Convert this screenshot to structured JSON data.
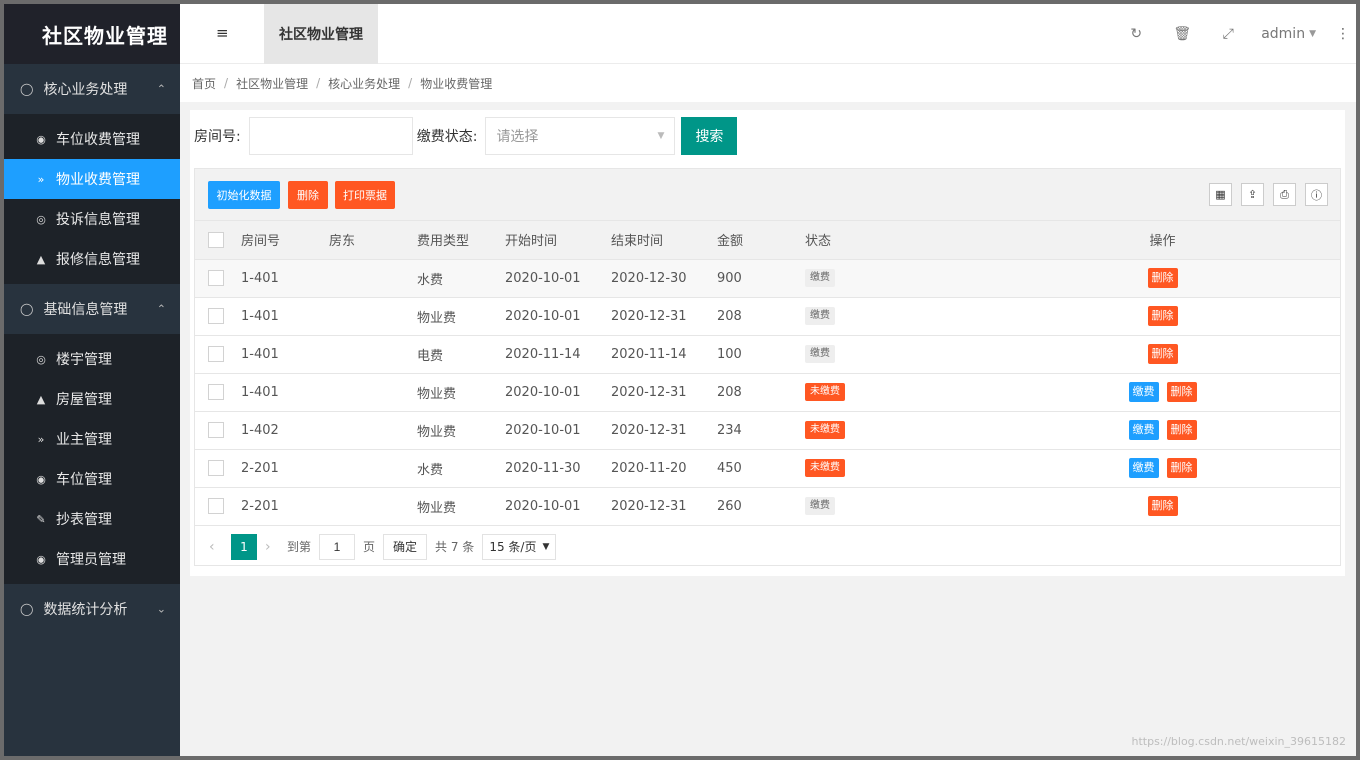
{
  "app": {
    "logo": "社区物业管理",
    "watermark": "https://blog.csdn.net/weixin_39615182"
  },
  "sidebar": {
    "groups": [
      {
        "title": "核心业务处理",
        "expanded": true,
        "items": [
          {
            "label": "车位收费管理",
            "icon": "dashboard-icon"
          },
          {
            "label": "物业收费管理",
            "icon": "double-chevron-icon",
            "active": true
          },
          {
            "label": "投诉信息管理",
            "icon": "target-icon"
          },
          {
            "label": "报修信息管理",
            "icon": "compass-icon"
          }
        ]
      },
      {
        "title": "基础信息管理",
        "expanded": true,
        "items": [
          {
            "label": "楼宇管理",
            "icon": "target-icon"
          },
          {
            "label": "房屋管理",
            "icon": "compass-icon"
          },
          {
            "label": "业主管理",
            "icon": "double-chevron-icon"
          },
          {
            "label": "车位管理",
            "icon": "dashboard-icon"
          },
          {
            "label": "抄表管理",
            "icon": "edit-icon"
          },
          {
            "label": "管理员管理",
            "icon": "user-circle-icon"
          }
        ]
      },
      {
        "title": "数据统计分析",
        "expanded": false,
        "items": []
      }
    ]
  },
  "header": {
    "tab": "社区物业管理",
    "user": "admin",
    "icons": [
      "refresh-icon",
      "trash-icon",
      "fullscreen-icon",
      "more-vertical-icon"
    ]
  },
  "breadcrumb": [
    "首页",
    "社区物业管理",
    "核心业务处理",
    "物业收费管理"
  ],
  "filter": {
    "room_label": "房间号:",
    "room_value": "",
    "status_label": "缴费状态:",
    "status_placeholder": "请选择",
    "search_button": "搜索"
  },
  "toolbar": {
    "init_button": "初始化数据",
    "delete_button": "删除",
    "print_button": "打印票据",
    "tools": [
      "columns-icon",
      "export-icon",
      "print-icon",
      "info-icon"
    ]
  },
  "table": {
    "columns": [
      "房间号",
      "房东",
      "费用类型",
      "开始时间",
      "结束时间",
      "金额",
      "状态",
      "操作"
    ],
    "rows": [
      {
        "room": "1-401",
        "owner": "",
        "type": "水费",
        "start": "2020-10-01",
        "end": "2020-12-30",
        "amount": "900",
        "status": "缴费",
        "paid": true
      },
      {
        "room": "1-401",
        "owner": "",
        "type": "物业费",
        "start": "2020-10-01",
        "end": "2020-12-31",
        "amount": "208",
        "status": "缴费",
        "paid": true
      },
      {
        "room": "1-401",
        "owner": "",
        "type": "电费",
        "start": "2020-11-14",
        "end": "2020-11-14",
        "amount": "100",
        "status": "缴费",
        "paid": true
      },
      {
        "room": "1-401",
        "owner": "",
        "type": "物业费",
        "start": "2020-10-01",
        "end": "2020-12-31",
        "amount": "208",
        "status": "未缴费",
        "paid": false
      },
      {
        "room": "1-402",
        "owner": "",
        "type": "物业费",
        "start": "2020-10-01",
        "end": "2020-12-31",
        "amount": "234",
        "status": "未缴费",
        "paid": false
      },
      {
        "room": "2-201",
        "owner": "",
        "type": "水费",
        "start": "2020-11-30",
        "end": "2020-11-20",
        "amount": "450",
        "status": "未缴费",
        "paid": false
      },
      {
        "room": "2-201",
        "owner": "",
        "type": "物业费",
        "start": "2020-10-01",
        "end": "2020-12-31",
        "amount": "260",
        "status": "缴费",
        "paid": true
      }
    ],
    "op_pay": "缴费",
    "op_delete": "删除"
  },
  "pager": {
    "current": "1",
    "goto_prefix": "到第",
    "goto_value": "1",
    "goto_suffix": "页",
    "confirm": "确定",
    "total": "共 7 条",
    "page_size": "15 条/页"
  },
  "colors": {
    "sidebar_bg": "#28333e",
    "active": "#1e9fff",
    "primary": "#009688",
    "danger": "#ff5722"
  }
}
